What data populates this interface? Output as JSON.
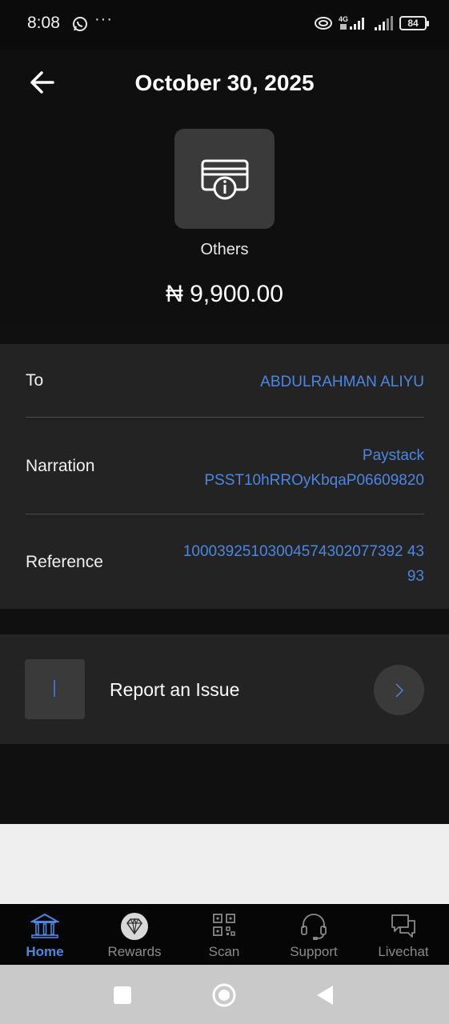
{
  "status_bar": {
    "time": "8:08",
    "more": "···",
    "network": "4G",
    "battery": "84"
  },
  "header": {
    "title": "October 30, 2025",
    "category": "Others",
    "amount": "₦ 9,900.00"
  },
  "details": {
    "to": {
      "label": "To",
      "value": "ABDULRAHMAN ALIYU"
    },
    "narration": {
      "label": "Narration",
      "value_line1": "Paystack",
      "value_line2": "PSST10hRROyKbqaP06609820"
    },
    "reference": {
      "label": "Reference",
      "value_line1": "10003925103004574302077392 43",
      "value_line2": "93"
    }
  },
  "report": {
    "label": "Report an Issue"
  },
  "bottom_nav": [
    {
      "label": "Home",
      "icon": "bank-icon",
      "active": true
    },
    {
      "label": "Rewards",
      "icon": "diamond-icon",
      "active": false
    },
    {
      "label": "Scan",
      "icon": "qr-code-icon",
      "active": false
    },
    {
      "label": "Support",
      "icon": "headset-icon",
      "active": false
    },
    {
      "label": "Livechat",
      "icon": "chat-icon",
      "active": false
    }
  ],
  "colors": {
    "accent": "#4d86e0",
    "background": "#101010",
    "card": "#232323"
  }
}
